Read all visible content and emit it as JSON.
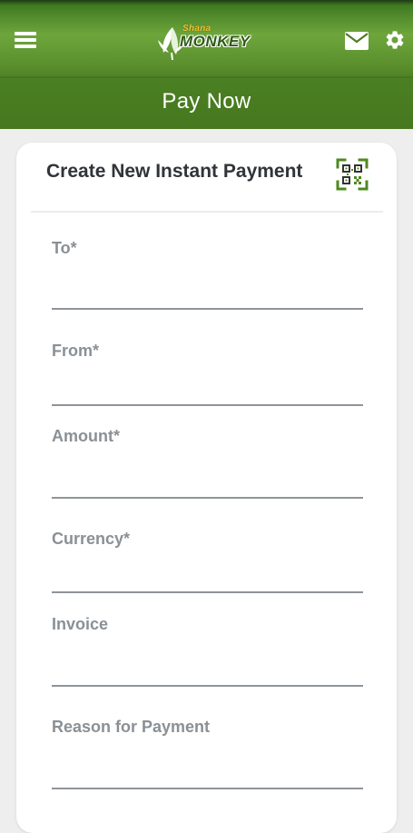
{
  "header": {
    "logo": {
      "top_text": "Shana",
      "main_text": "MONKEY"
    },
    "title": "Pay Now",
    "icons": {
      "menu": "hamburger-menu-icon",
      "mail": "envelope-icon",
      "settings": "gear-icon"
    }
  },
  "card": {
    "title": "Create New Instant Payment",
    "scan_icon": "qr-code-scan-icon",
    "fields": [
      {
        "label": "To*",
        "value": ""
      },
      {
        "label": "From*",
        "value": ""
      },
      {
        "label": "Amount*",
        "value": ""
      },
      {
        "label": "Currency*",
        "value": ""
      },
      {
        "label": "Invoice",
        "value": ""
      },
      {
        "label": "Reason for Payment",
        "value": ""
      }
    ]
  },
  "colors": {
    "header_green": "#5a8f2d",
    "qr_green": "#4e8a1f",
    "label_gray": "#8a9095",
    "title_dark": "#303438"
  }
}
